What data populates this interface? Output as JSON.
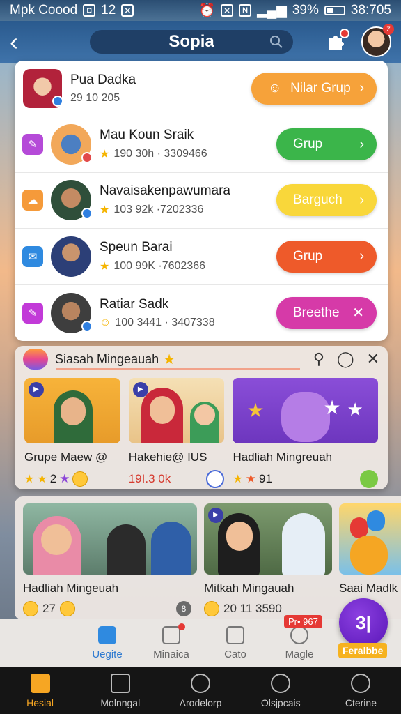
{
  "status_bar": {
    "carrier": "Mpk Coood",
    "notif_count": "12",
    "battery": "39%",
    "time": "38:705",
    "battery_level": 0.39
  },
  "header": {
    "title": "Sopia"
  },
  "groups": [
    {
      "name": "Pua Dadka",
      "meta": "29 10 205",
      "button": "Nilar Grup",
      "button_color": "#f6a23a",
      "button_icon": "chevron-right"
    },
    {
      "name": "Mau Koun Sraik",
      "meta": "190 30h · 3309466",
      "button": "Grup",
      "button_color": "#3bb54a",
      "button_icon": "chevron-right",
      "lead_color": "#b54ad8"
    },
    {
      "name": "Navaisakenpawumara",
      "meta": "103 92k ·7202336",
      "button": "Barguch",
      "button_color": "#f9d73a",
      "button_icon": "chevron-right",
      "lead_color": "#f59a3a"
    },
    {
      "name": "Speun Barai",
      "meta": "100 99K ·7602366",
      "button": "Grup",
      "button_color": "#ee5a2a",
      "button_icon": "chevron-right",
      "lead_color": "#2f8ae0"
    },
    {
      "name": "Ratiar Sadk",
      "meta": "100 3441 · 3407338",
      "button": "Breethe",
      "button_color": "#d63aa8",
      "button_icon": "close",
      "lead_color": "#c23ad8"
    }
  ],
  "featured": {
    "title": "Siasah Mingeauah",
    "cards": [
      {
        "name": "Grupe Maew @",
        "meta": "2"
      },
      {
        "name": "Hakehie@ IUS",
        "meta": "19I.3 0k"
      },
      {
        "name": "Hadliah Mingreuah",
        "meta": "91"
      }
    ]
  },
  "videos": [
    {
      "name": "Hadliah Mingeuah",
      "meta": "27"
    },
    {
      "name": "Mitkah Mingauah",
      "meta": "20 11 3590"
    },
    {
      "name": "Saai Madlk",
      "meta": ""
    }
  ],
  "tabs": [
    {
      "label": "Uegite",
      "active": true
    },
    {
      "label": "Minaica",
      "active": false
    },
    {
      "label": "Cato",
      "active": false
    },
    {
      "label": "Magle",
      "active": false
    }
  ],
  "price_tag": "Pr• 967",
  "fab": {
    "glyph": "3|",
    "label": "Feralbbe"
  },
  "nav": [
    {
      "label": "Hesial",
      "active": true
    },
    {
      "label": "Molnngal",
      "active": false
    },
    {
      "label": "Arodelorp",
      "active": false
    },
    {
      "label": "Olsjpcais",
      "active": false
    },
    {
      "label": "Cterine",
      "active": false
    }
  ]
}
